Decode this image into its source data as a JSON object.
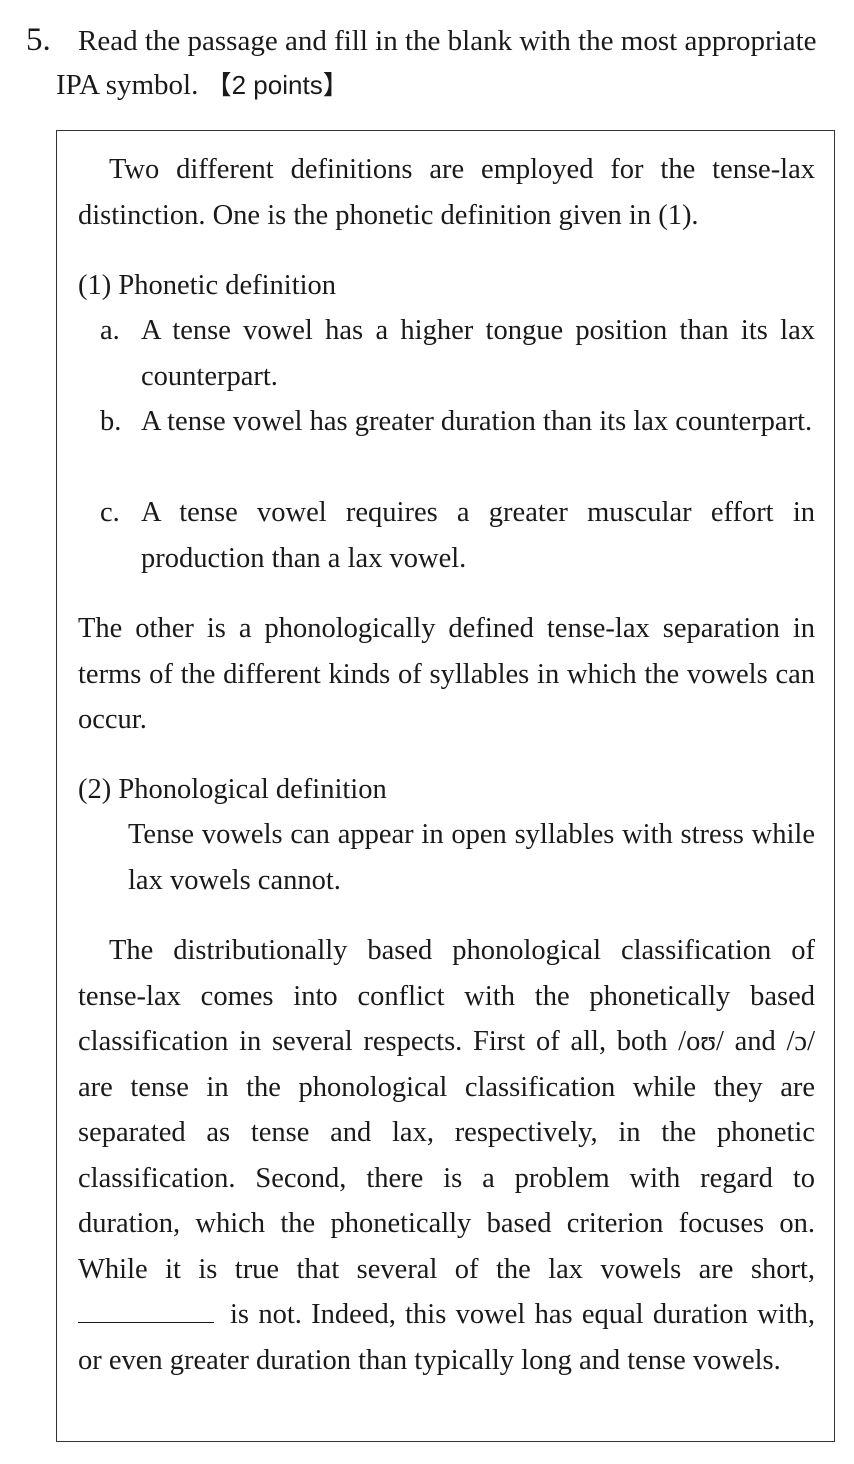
{
  "question": {
    "number": "5.",
    "line1": "Read the passage and fill in the blank with the most appropriate",
    "line2": "IPA symbol.",
    "points": "【2 points】"
  },
  "passage": {
    "intro": "Two different definitions are employed for the tense-lax distinction. One is the phonetic definition given in (1).",
    "def1_title": "(1) Phonetic definition",
    "def1_items": [
      {
        "label": "a.",
        "text": "A tense vowel has a higher tongue position than its lax counterpart."
      },
      {
        "label": "b.",
        "text": "A tense vowel has greater duration than its lax counterpart."
      },
      {
        "label": "c.",
        "text": "A tense vowel requires a greater muscular effort in production than a lax vowel."
      }
    ],
    "middle": "The other is a phonologically defined tense-lax separation in terms of the different kinds of syllables in which the vowels can occur.",
    "def2_title": "(2) Phonological definition",
    "def2_text": "Tense vowels can appear in open syllables with stress while lax vowels cannot.",
    "final_before_blank": "The distributionally based phonological classification of tense-lax comes into conflict with the phonetically based classification in several respects. First of all, both /oʊ/ and /ɔ/ are tense in the phonological classification while they are separated as tense and lax, respectively, in the phonetic classification. Second, there is a problem with regard to duration, which the phonetically based criterion focuses on. While it is true that several of the lax vowels are short,",
    "final_after_blank": "is not. Indeed, this vowel has equal duration with, or even greater duration than typically long and tense vowels."
  }
}
